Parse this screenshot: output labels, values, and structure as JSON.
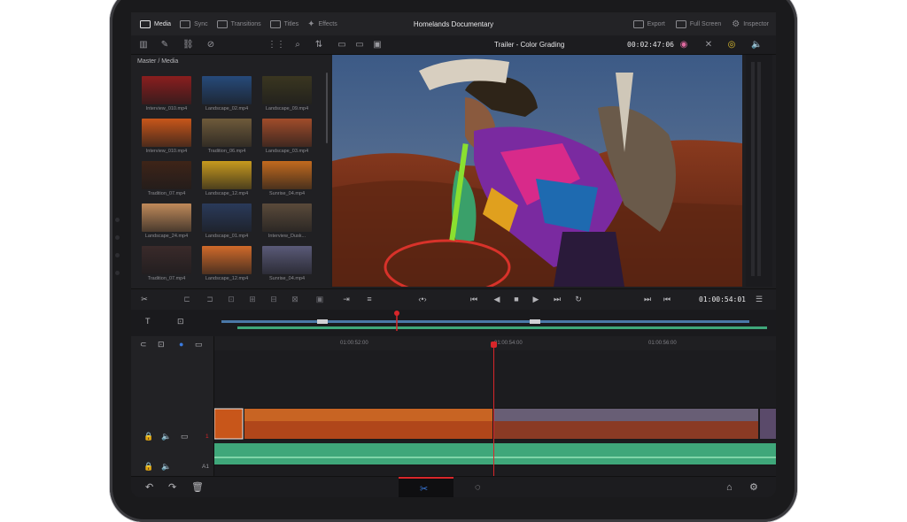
{
  "app": {
    "title": "Homelands Documentary",
    "nav": [
      "Media",
      "Sync",
      "Transitions",
      "Titles",
      "Effects"
    ],
    "right_nav": [
      "Export",
      "Full Screen",
      "Inspector"
    ]
  },
  "viewer": {
    "clip_title": "Trailer - Color Grading",
    "timecode_top": "00:02:47:06",
    "timecode_play": "01:00:54:01"
  },
  "media": {
    "breadcrumb": "Master / Media",
    "clips": [
      {
        "name": "Interview_010.mp4",
        "color": "#8a1e1e"
      },
      {
        "name": "Landscape_02.mp4",
        "color": "#264a7a"
      },
      {
        "name": "Landscape_09.mp4",
        "color": "#3a3620"
      },
      {
        "name": "Interview_010.mp4",
        "color": "#c8561a"
      },
      {
        "name": "Tradition_06.mp4",
        "color": "#6e5a3a"
      },
      {
        "name": "Landscape_03.mp4",
        "color": "#a04c2a"
      },
      {
        "name": "Tradition_07.mp4",
        "color": "#3e2418"
      },
      {
        "name": "Landscape_12.mp4",
        "color": "#c89a1e"
      },
      {
        "name": "Sunrise_04.mp4",
        "color": "#c26a1e"
      },
      {
        "name": "Landscape_24.mp4",
        "color": "#c08a5a"
      },
      {
        "name": "Landscape_01.mp4",
        "color": "#2a3a5a"
      },
      {
        "name": "Interview_Dusk...",
        "color": "#5a4a3a"
      },
      {
        "name": "Tradition_07.mp4",
        "color": "#3a2a2a"
      },
      {
        "name": "Landscape_12.mp4",
        "color": "#d06a2a"
      },
      {
        "name": "Sunrise_04.mp4",
        "color": "#5a5a78"
      }
    ]
  },
  "timeline": {
    "ticks": [
      "01:00:52:00",
      "01:00:54:00",
      "01:00:56:00"
    ],
    "video_track": "1",
    "audio_track": "A1"
  },
  "colors": {
    "accent": "#d8262a",
    "audio": "#3fa77a",
    "sky": "#3f5a80"
  }
}
